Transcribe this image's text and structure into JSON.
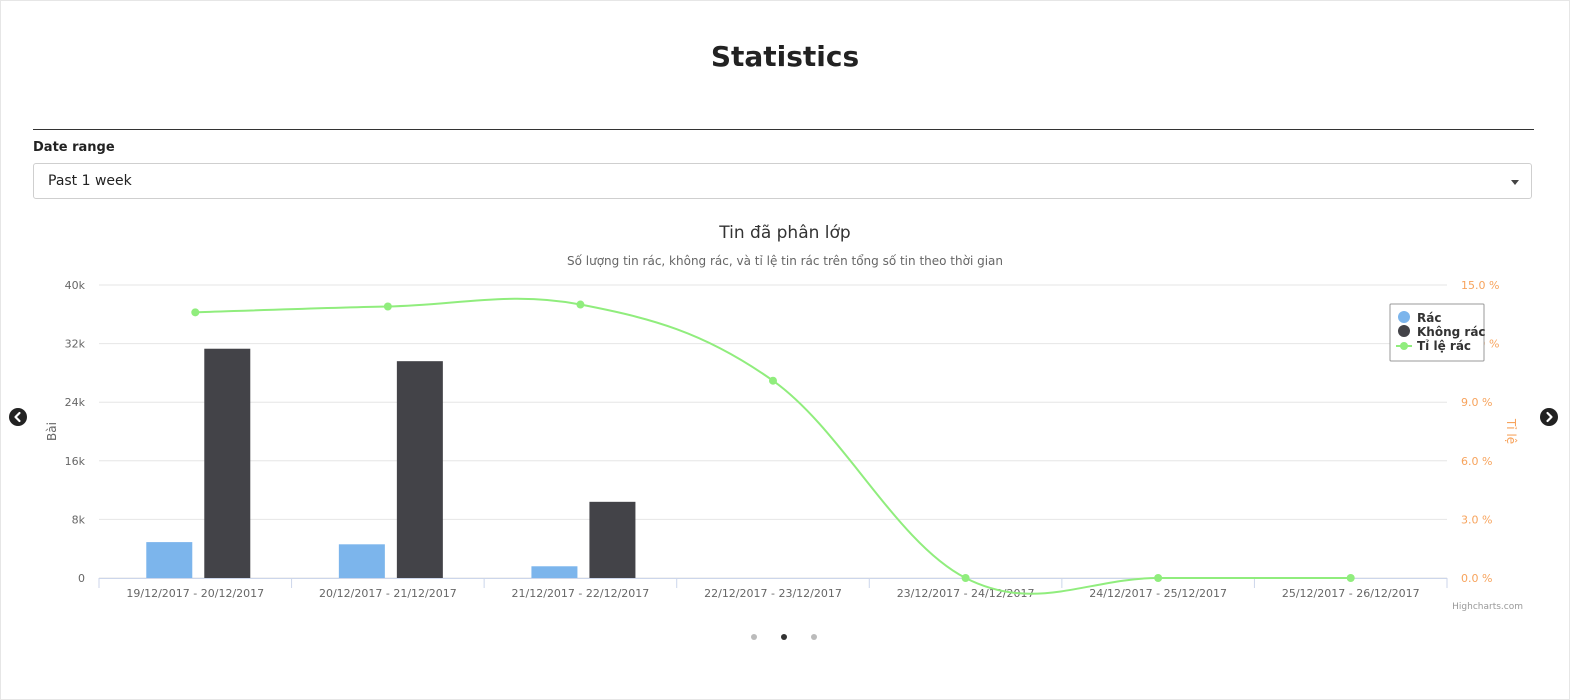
{
  "header": {
    "title": "Statistics"
  },
  "filter": {
    "label": "Date range",
    "selected": "Past 1 week"
  },
  "credits": "Highcharts.com",
  "nav": {
    "prev_icon": "chevron-left-circle-icon",
    "next_icon": "chevron-right-circle-icon"
  },
  "carousel": {
    "count": 3,
    "active_index": 1
  },
  "colors": {
    "rac": "#7cb5ec",
    "khong_rac": "#434348",
    "ti_le": "#90ed7d",
    "right_axis": "#f7a35c"
  },
  "chart_data": {
    "type": "bar",
    "title": "Tin đã phân lớp",
    "subtitle": "Số lượng tin rác, không rác, và tỉ lệ tin rác trên tổng số tin theo thời gian",
    "categories": [
      "19/12/2017 - 20/12/2017",
      "20/12/2017 - 21/12/2017",
      "21/12/2017 - 22/12/2017",
      "22/12/2017 - 23/12/2017",
      "23/12/2017 - 24/12/2017",
      "24/12/2017 - 25/12/2017",
      "25/12/2017 - 26/12/2017"
    ],
    "ylabel": "Bài",
    "y2label": "Tỉ lệ",
    "ylim": [
      0,
      40000
    ],
    "y2lim": [
      0,
      15
    ],
    "yticks": [
      "0",
      "8k",
      "16k",
      "24k",
      "32k",
      "40k"
    ],
    "y2ticks": [
      "0.0 %",
      "3.0 %",
      "6.0 %",
      "9.0 %",
      "12.0 %",
      "15.0 %"
    ],
    "series": [
      {
        "name": "Rác",
        "type": "column",
        "values": [
          4900,
          4600,
          1600,
          0,
          0,
          0,
          0
        ]
      },
      {
        "name": "Không rác",
        "type": "column",
        "values": [
          31300,
          29600,
          10400,
          0,
          0,
          0,
          0
        ]
      },
      {
        "name": "Tỉ lệ rác",
        "type": "spline",
        "axis": "right",
        "values": [
          13.6,
          13.9,
          14.0,
          10.1,
          0,
          0,
          0
        ]
      }
    ],
    "legend": "top-right",
    "grid": true
  }
}
